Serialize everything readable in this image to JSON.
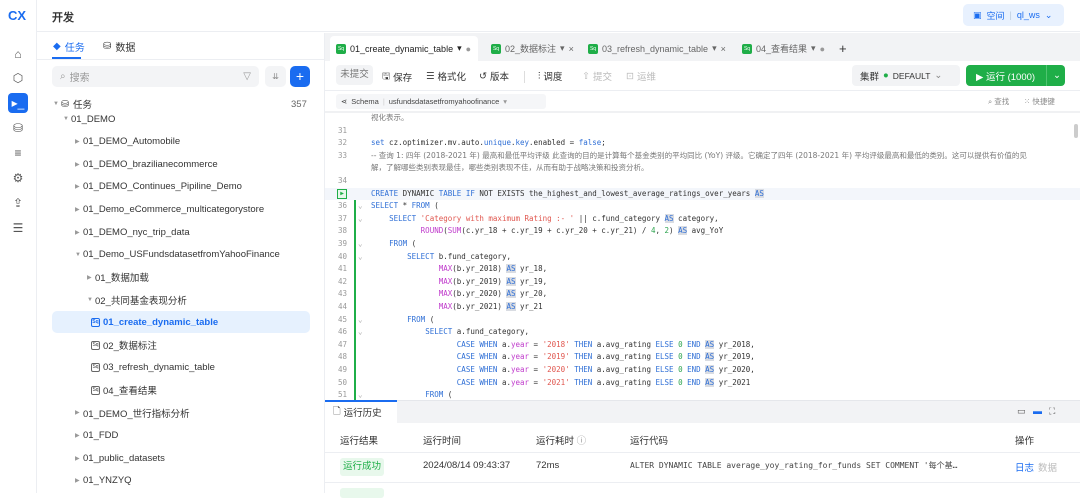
{
  "header": {
    "title": "开发",
    "workspace_label": "空间",
    "workspace_name": "ql_ws"
  },
  "rail": [
    "home-icon",
    "cube-icon",
    "terminal-icon",
    "database-icon",
    "list-icon",
    "monitor-icon",
    "share-icon",
    "layers-icon"
  ],
  "left": {
    "tabs": [
      "任务",
      "数据"
    ],
    "search_placeholder": "搜索",
    "root": {
      "label": "任务",
      "count": "357"
    },
    "tree": [
      {
        "label": "01_DEMO",
        "level": 0,
        "open": true
      },
      {
        "label": "01_DEMO_Automobile",
        "level": 1
      },
      {
        "label": "01_DEMO_brazilianecommerce",
        "level": 1
      },
      {
        "label": "01_DEMO_Continues_Pipiline_Demo",
        "level": 1
      },
      {
        "label": "01_Demo_eCommerce_multicategorystore",
        "level": 1
      },
      {
        "label": "01_DEMO_nyc_trip_data",
        "level": 1
      },
      {
        "label": "01_Demo_USFundsdatasetfromYahooFinance",
        "level": 1,
        "open": true
      },
      {
        "label": "01_数据加载",
        "level": 2
      },
      {
        "label": "02_共同基金表现分析",
        "level": 2,
        "open": true
      },
      {
        "label": "01_create_dynamic_table",
        "level": 3,
        "file": true,
        "selected": true
      },
      {
        "label": "02_数据标注",
        "level": 3,
        "file": true
      },
      {
        "label": "03_refresh_dynamic_table",
        "level": 3,
        "file": true
      },
      {
        "label": "04_查看结果",
        "level": 3,
        "file": true
      },
      {
        "label": "01_DEMO_世行指标分析",
        "level": 1
      },
      {
        "label": "01_FDD",
        "level": 1
      },
      {
        "label": "01_public_datasets",
        "level": 1
      },
      {
        "label": "01_YNZYQ",
        "level": 1
      }
    ]
  },
  "tabs": [
    {
      "label": "01_create_dynamic_table",
      "status": "●"
    },
    {
      "label": "02_数据标注",
      "status": "×"
    },
    {
      "label": "03_refresh_dynamic_table",
      "status": "×"
    },
    {
      "label": "04_查看结果",
      "status": "●"
    }
  ],
  "toolbar": {
    "uncommitted": "未提交",
    "save": "保存",
    "format": "格式化",
    "version": "版本",
    "schedule": "调度",
    "submit": "提交",
    "ops": "运维",
    "cluster": "集群",
    "cluster_name": "DEFAULT",
    "run": "运行 (1000)"
  },
  "schema": {
    "label": "Schema",
    "value": "usfundsdatasetfromyahoofinance",
    "find": "查找",
    "shortcuts": "快捷键"
  },
  "code": [
    {
      "n": "",
      "t": [
        [
          "视化表示。",
          "c"
        ]
      ]
    },
    {
      "n": "31",
      "t": []
    },
    {
      "n": "32",
      "t": [
        [
          "set",
          "k"
        ],
        [
          " cz.optimizer.mv.auto.",
          "p"
        ],
        [
          "unique",
          "k"
        ],
        [
          ".",
          "p"
        ],
        [
          "key",
          "k"
        ],
        [
          ".enabled = ",
          "p"
        ],
        [
          "false",
          "k"
        ],
        [
          ";",
          "p"
        ]
      ]
    },
    {
      "n": "33",
      "t": [
        [
          "-- 查询 1: 四年 (2018-2021 年) 最高和最低平均评级 此查询的目的是计算每个基金类别的平均同比 (YoY) 评级。它确定了四年 (2018-2021 年) 平均评级最高和最低的类别。这可以提供有价值的见",
          "c"
        ]
      ]
    },
    {
      "n": "",
      "t": [
        [
          "解，了解哪些类别表现最佳，哪些类别表现不佳，从而有助于战略决策和投资分析。",
          "c"
        ]
      ]
    },
    {
      "n": "34",
      "t": []
    },
    {
      "n": "35",
      "run": true,
      "t": [
        [
          "CREATE",
          "k"
        ],
        [
          " DYNAMIC ",
          "p"
        ],
        [
          "TABLE IF",
          "k"
        ],
        [
          " NOT EXISTS ",
          "p"
        ],
        [
          "the_highest_and_lowest_average_ratings_over_years ",
          "p"
        ],
        [
          "AS",
          "as"
        ]
      ]
    },
    {
      "n": "36",
      "fold": true,
      "t": [
        [
          "SELECT",
          "k"
        ],
        [
          " * ",
          "p"
        ],
        [
          "FROM",
          "k"
        ],
        [
          " (",
          "p"
        ]
      ]
    },
    {
      "n": "37",
      "fold": true,
      "t": [
        [
          "    ",
          "p"
        ],
        [
          "SELECT",
          "k"
        ],
        [
          " ",
          "p"
        ],
        [
          "'Category with maximum Rating :- '",
          "s"
        ],
        [
          " || c.fund_category ",
          "p"
        ],
        [
          "AS",
          "as"
        ],
        [
          " category,",
          "p"
        ]
      ]
    },
    {
      "n": "38",
      "t": [
        [
          "           ",
          "p"
        ],
        [
          "ROUND",
          "f"
        ],
        [
          "(",
          "p"
        ],
        [
          "SUM",
          "f"
        ],
        [
          "(c.yr_18 + c.yr_19 + c.yr_20 + c.yr_21) / ",
          "p"
        ],
        [
          "4",
          "n"
        ],
        [
          ", ",
          "p"
        ],
        [
          "2",
          "n"
        ],
        [
          ") ",
          "p"
        ],
        [
          "AS",
          "as"
        ],
        [
          " avg_YoY",
          "p"
        ]
      ]
    },
    {
      "n": "39",
      "fold": true,
      "t": [
        [
          "    ",
          "p"
        ],
        [
          "FROM",
          "k"
        ],
        [
          " (",
          "p"
        ]
      ]
    },
    {
      "n": "40",
      "fold": true,
      "t": [
        [
          "        ",
          "p"
        ],
        [
          "SELECT",
          "k"
        ],
        [
          " b.fund_category,",
          "p"
        ]
      ]
    },
    {
      "n": "41",
      "t": [
        [
          "               ",
          "p"
        ],
        [
          "MAX",
          "f"
        ],
        [
          "(b.yr_2018) ",
          "p"
        ],
        [
          "AS",
          "as"
        ],
        [
          " yr_18,",
          "p"
        ]
      ]
    },
    {
      "n": "42",
      "t": [
        [
          "               ",
          "p"
        ],
        [
          "MAX",
          "f"
        ],
        [
          "(b.yr_2019) ",
          "p"
        ],
        [
          "AS",
          "as"
        ],
        [
          " yr_19,",
          "p"
        ]
      ]
    },
    {
      "n": "43",
      "t": [
        [
          "               ",
          "p"
        ],
        [
          "MAX",
          "f"
        ],
        [
          "(b.yr_2020) ",
          "p"
        ],
        [
          "AS",
          "as"
        ],
        [
          " yr_20,",
          "p"
        ]
      ]
    },
    {
      "n": "44",
      "t": [
        [
          "               ",
          "p"
        ],
        [
          "MAX",
          "f"
        ],
        [
          "(b.yr_2021) ",
          "p"
        ],
        [
          "AS",
          "as"
        ],
        [
          " yr_21",
          "p"
        ]
      ]
    },
    {
      "n": "45",
      "fold": true,
      "t": [
        [
          "        ",
          "p"
        ],
        [
          "FROM",
          "k"
        ],
        [
          " (",
          "p"
        ]
      ]
    },
    {
      "n": "46",
      "fold": true,
      "t": [
        [
          "            ",
          "p"
        ],
        [
          "SELECT",
          "k"
        ],
        [
          " a.fund_category,",
          "p"
        ]
      ]
    },
    {
      "n": "47",
      "t": [
        [
          "                   ",
          "p"
        ],
        [
          "CASE WHEN",
          "k"
        ],
        [
          " a.",
          "p"
        ],
        [
          "year",
          "y"
        ],
        [
          " = ",
          "p"
        ],
        [
          "'2018'",
          "s"
        ],
        [
          " ",
          "p"
        ],
        [
          "THEN",
          "k"
        ],
        [
          " a.avg_rating ",
          "p"
        ],
        [
          "ELSE",
          "k"
        ],
        [
          " ",
          "p"
        ],
        [
          "0",
          "n"
        ],
        [
          " ",
          "p"
        ],
        [
          "END",
          "k"
        ],
        [
          " ",
          "p"
        ],
        [
          "AS",
          "as"
        ],
        [
          " yr_2018,",
          "p"
        ]
      ]
    },
    {
      "n": "48",
      "t": [
        [
          "                   ",
          "p"
        ],
        [
          "CASE WHEN",
          "k"
        ],
        [
          " a.",
          "p"
        ],
        [
          "year",
          "y"
        ],
        [
          " = ",
          "p"
        ],
        [
          "'2019'",
          "s"
        ],
        [
          " ",
          "p"
        ],
        [
          "THEN",
          "k"
        ],
        [
          " a.avg_rating ",
          "p"
        ],
        [
          "ELSE",
          "k"
        ],
        [
          " ",
          "p"
        ],
        [
          "0",
          "n"
        ],
        [
          " ",
          "p"
        ],
        [
          "END",
          "k"
        ],
        [
          " ",
          "p"
        ],
        [
          "AS",
          "as"
        ],
        [
          " yr_2019,",
          "p"
        ]
      ]
    },
    {
      "n": "49",
      "t": [
        [
          "                   ",
          "p"
        ],
        [
          "CASE WHEN",
          "k"
        ],
        [
          " a.",
          "p"
        ],
        [
          "year",
          "y"
        ],
        [
          " = ",
          "p"
        ],
        [
          "'2020'",
          "s"
        ],
        [
          " ",
          "p"
        ],
        [
          "THEN",
          "k"
        ],
        [
          " a.avg_rating ",
          "p"
        ],
        [
          "ELSE",
          "k"
        ],
        [
          " ",
          "p"
        ],
        [
          "0",
          "n"
        ],
        [
          " ",
          "p"
        ],
        [
          "END",
          "k"
        ],
        [
          " ",
          "p"
        ],
        [
          "AS",
          "as"
        ],
        [
          " yr_2020,",
          "p"
        ]
      ]
    },
    {
      "n": "50",
      "t": [
        [
          "                   ",
          "p"
        ],
        [
          "CASE WHEN",
          "k"
        ],
        [
          " a.",
          "p"
        ],
        [
          "year",
          "y"
        ],
        [
          " = ",
          "p"
        ],
        [
          "'2021'",
          "s"
        ],
        [
          " ",
          "p"
        ],
        [
          "THEN",
          "k"
        ],
        [
          " a.avg_rating ",
          "p"
        ],
        [
          "ELSE",
          "k"
        ],
        [
          " ",
          "p"
        ],
        [
          "0",
          "n"
        ],
        [
          " ",
          "p"
        ],
        [
          "END",
          "k"
        ],
        [
          " ",
          "p"
        ],
        [
          "AS",
          "as"
        ],
        [
          " yr_2021",
          "p"
        ]
      ]
    },
    {
      "n": "51",
      "fold": true,
      "t": [
        [
          "            ",
          "p"
        ],
        [
          "FROM",
          "k"
        ],
        [
          " (",
          "p"
        ]
      ]
    }
  ],
  "history": {
    "tab": "运行历史",
    "columns": [
      "运行结果",
      "运行时间",
      "运行耗时",
      "运行代码",
      "操作"
    ],
    "rows": [
      {
        "status": "运行成功",
        "time": "2024/08/14 09:43:37",
        "duration": "72ms",
        "code": "ALTER DYNAMIC TABLE average_yoy_rating_for_funds SET COMMENT '每个基…",
        "log": "日志",
        "data": "数据"
      }
    ]
  },
  "colors": {
    "accent": "#1a6cf0",
    "run": "#1fae48"
  }
}
